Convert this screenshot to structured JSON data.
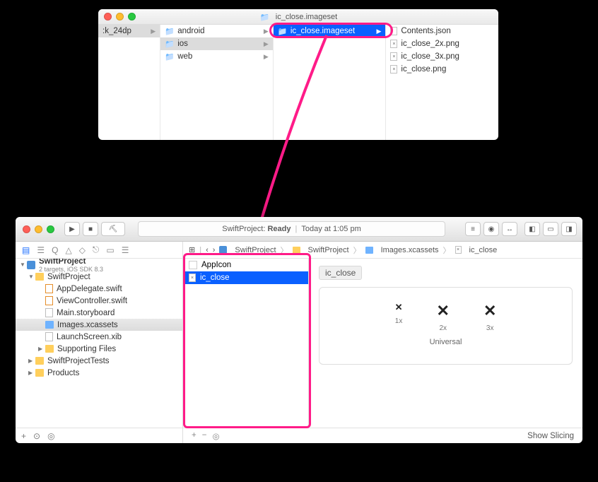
{
  "finder": {
    "title": "ic_close.imageset",
    "col1": {
      "items": [
        {
          "label": ":k_24dp"
        }
      ]
    },
    "col2": {
      "items": [
        {
          "label": "android"
        },
        {
          "label": "ios"
        },
        {
          "label": "web"
        }
      ]
    },
    "col3": {
      "items": [
        {
          "label": "ic_close.imageset"
        }
      ]
    },
    "col4": {
      "items": [
        {
          "label": "Contents.json"
        },
        {
          "label": "ic_close_2x.png"
        },
        {
          "label": "ic_close_3x.png"
        },
        {
          "label": "ic_close.png"
        }
      ]
    }
  },
  "xcode": {
    "status_left": "SwiftProject:",
    "status_mid": "Ready",
    "status_right": "Today at 1:05 pm",
    "jumpbar": [
      "SwiftProject",
      "SwiftProject",
      "Images.xcassets",
      "ic_close"
    ],
    "project": {
      "name": "SwiftProject",
      "subtitle": "2 targets, iOS SDK 8.3",
      "folder": "SwiftProject",
      "files": [
        "AppDelegate.swift",
        "ViewController.swift",
        "Main.storyboard",
        "Images.xcassets",
        "LaunchScreen.xib"
      ],
      "supporting": "Supporting Files",
      "tests": "SwiftProjectTests",
      "products": "Products"
    },
    "assets": {
      "appicon": "AppIcon",
      "icclose": "ic_close"
    },
    "preview": {
      "title": "ic_close",
      "labels": [
        "1x",
        "2x",
        "3x"
      ],
      "universal": "Universal"
    },
    "slicing": "Show Slicing"
  }
}
